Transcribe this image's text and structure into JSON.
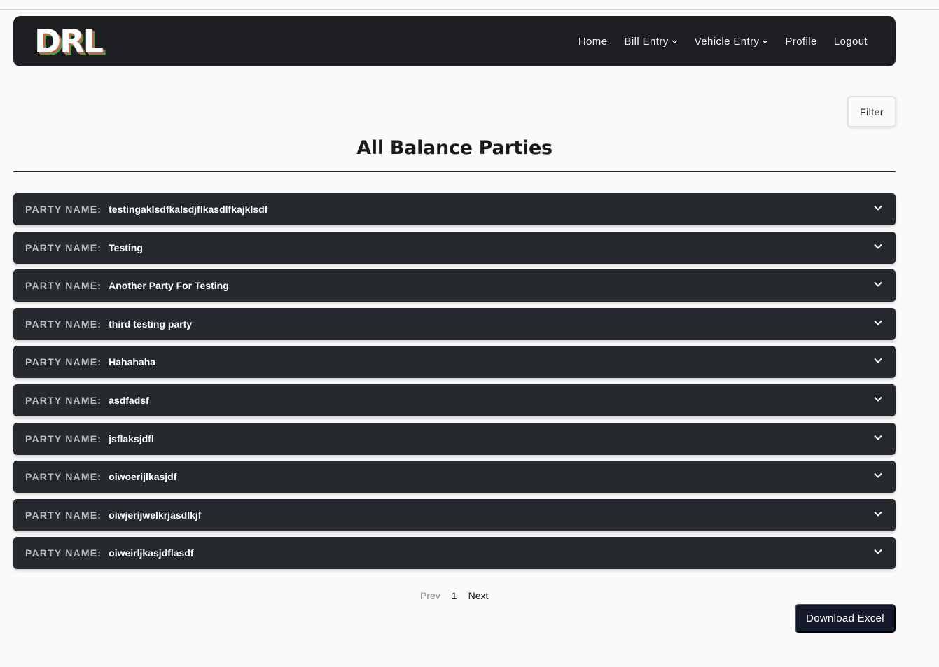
{
  "brand": {
    "logo_text": "DRL"
  },
  "nav": {
    "home": "Home",
    "bill_entry": "Bill Entry",
    "vehicle_entry": "Vehicle Entry",
    "profile": "Profile",
    "logout": "Logout"
  },
  "filter": {
    "label": "Filter"
  },
  "page": {
    "title": "All Balance Parties"
  },
  "parties": {
    "label": "PARTY NAME:",
    "items": [
      "testingaklsdfkalsdjflkasdlfkajklsdf",
      "Testing",
      "Another Party For Testing",
      "third testing party",
      "Hahahaha",
      "asdfadsf",
      "jsflaksjdfl",
      "oiwoerijlkasjdf",
      "oiwjerijwelkrjasdlkjf",
      "oiweirljkasjdflasdf"
    ]
  },
  "pagination": {
    "prev": "Prev",
    "current": "1",
    "next": "Next"
  },
  "download": {
    "label": "Download Excel"
  }
}
